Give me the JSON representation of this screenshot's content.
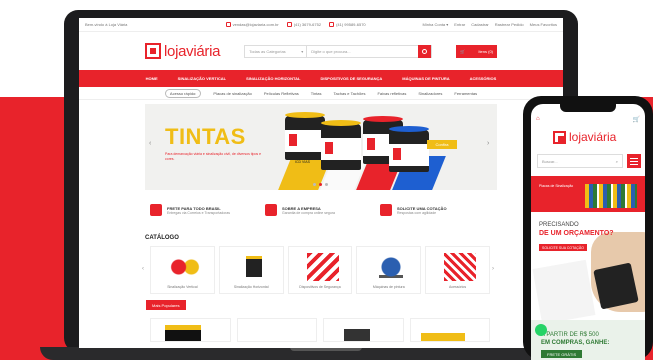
{
  "colors": {
    "brand_red": "#e8232b",
    "yellow": "#f0bd16",
    "green": "#2f7a34",
    "whatsapp": "#25d366"
  },
  "desktop": {
    "topbar": {
      "welcome": "Bem-vindo à Loja Viária",
      "email": "vendas@lojaviaria.com.br",
      "phone": "(41) 3679-6752",
      "whatsapp": "(41) 99589-6570",
      "links": [
        "Minha Conta ▾",
        "Entrar",
        "Cadastrar",
        "Rastrear Pedido",
        "Meus Favoritos"
      ]
    },
    "header": {
      "logo_text": "lojaviária",
      "search_category": "Todas as Categorias",
      "search_placeholder": "Digite o que procura...",
      "cart_label": "Itens (0)",
      "icons": {
        "search": "search-icon",
        "cart": "cart-icon"
      }
    },
    "main_nav": [
      "HOME",
      "SINALIZAÇÃO VERTICAL",
      "SINALIZAÇÃO HORIZONTAL",
      "DISPOSITIVOS DE SEGURANÇA",
      "MÁQUINAS DE PINTURA",
      "ACESSÓRIOS"
    ],
    "sub_nav": [
      "Acesso rápido:",
      "Placas de sinalização",
      "Películas Refletivas",
      "Tintas",
      "Tachas e Tachões",
      "Faixas refletivas",
      "Sinalizadores",
      "Ferramentas"
    ],
    "banner": {
      "title": "TINTAS",
      "subtitle": "Para demarcação viária e sinalização civil, de diversos tipos e cores.",
      "cta": "Confira",
      "can_brand": "ICD VIAS"
    },
    "features": [
      {
        "title": "FRETE PARA TODO BRASIL",
        "text": "Entregas via Correios e Transportadoras"
      },
      {
        "title": "SOBRE A EMPRESA",
        "text": "Garantia de compra online segura"
      },
      {
        "title": "SOLICITE UMA COTAÇÃO",
        "text": "Respostas com agilidade"
      }
    ],
    "catalog": {
      "title": "CATÁLOGO",
      "items": [
        "Sinalização Vertical",
        "Sinalização Horizontal",
        "Dispositivos de Segurança",
        "Máquinas de pintura",
        "Acessórios"
      ]
    },
    "popular_label": "Mais Populares"
  },
  "mobile": {
    "logo_text": "lojaviária",
    "search_placeholder": "Buscar...",
    "banner_text": "Placas de Sinalização",
    "quote": {
      "line1": "PRECISANDO",
      "line2": "DE UM ORÇAMENTO?",
      "button": "SOLICITE SUA COTAÇÃO"
    },
    "promo": {
      "line1": "A PARTIR DE R$ 500",
      "line2": "EM COMPRAS, GANHE:",
      "badge": "FRETE GRÁTIS"
    }
  }
}
